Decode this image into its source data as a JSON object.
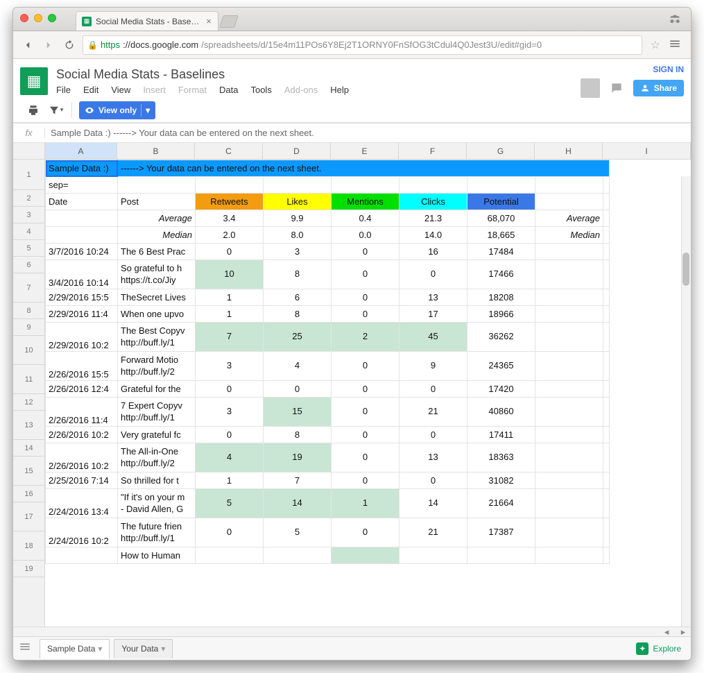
{
  "browser": {
    "tab_title": "Social Media Stats - Basel…",
    "url_https": "https",
    "url_host": "://docs.google.com",
    "url_rest": "/spreadsheets/d/15e4m11POs6Y8Ej2T1ORNY0FnSfOG3tCdul4Q0Jest3U/edit#gid=0"
  },
  "header": {
    "title": "Social Media Stats - Baselines",
    "sign_in": "SIGN IN",
    "share": "Share",
    "menu": {
      "file": "File",
      "edit": "Edit",
      "view": "View",
      "insert": "Insert",
      "format": "Format",
      "data": "Data",
      "tools": "Tools",
      "addons": "Add-ons",
      "help": "Help"
    }
  },
  "toolbar": {
    "view_only": "View only"
  },
  "formula_bar": "Sample Data :)  ------> Your data can be entered on the next sheet.",
  "columns": [
    "A",
    "B",
    "C",
    "D",
    "E",
    "F",
    "G",
    "H",
    "I"
  ],
  "row1": {
    "a": "Sample Data :)",
    "rest": "------> Your data can be entered on the next sheet."
  },
  "row2a": "sep=",
  "row3": {
    "date": "Date",
    "post": "Post",
    "rt": "Retweets",
    "likes": "Likes",
    "mentions": "Mentions",
    "clicks": "Clicks",
    "potential": "Potential"
  },
  "avg_row": {
    "label": "Average",
    "rt": "3.4",
    "likes": "9.9",
    "mentions": "0.4",
    "clicks": "21.3",
    "potential": "68,070",
    "label2": "Average"
  },
  "med_row": {
    "label": "Median",
    "rt": "2.0",
    "likes": "8.0",
    "mentions": "0.0",
    "clicks": "14.0",
    "potential": "18,665",
    "label2": "Median"
  },
  "data_rows": [
    {
      "n": "6",
      "date": "3/7/2016 10:24",
      "post": "The 6 Best Prac",
      "rt": "0",
      "likes": "3",
      "mentions": "0",
      "clicks": "16",
      "pot": "17484",
      "hl": []
    },
    {
      "n": "7",
      "date": "3/4/2016 10:14",
      "post": "So grateful to h\nhttps://t.co/Jiy",
      "rt": "10",
      "likes": "8",
      "mentions": "0",
      "clicks": "0",
      "pot": "17466",
      "hl": [
        "rt"
      ],
      "tall": true
    },
    {
      "n": "8",
      "date": "2/29/2016 15:5",
      "post": "TheSecret Lives",
      "rt": "1",
      "likes": "6",
      "mentions": "0",
      "clicks": "13",
      "pot": "18208",
      "hl": []
    },
    {
      "n": "9",
      "date": "2/29/2016 11:4",
      "post": "When one upvo",
      "rt": "1",
      "likes": "8",
      "mentions": "0",
      "clicks": "17",
      "pot": "18966",
      "hl": []
    },
    {
      "n": "10",
      "date": "2/29/2016 10:2",
      "post": "The Best Copyv\nhttp://buff.ly/1",
      "rt": "7",
      "likes": "25",
      "mentions": "2",
      "clicks": "45",
      "pot": "36262",
      "hl": [
        "rt",
        "likes",
        "mentions",
        "clicks"
      ],
      "tall": true
    },
    {
      "n": "11",
      "date": "2/26/2016 15:5",
      "post": "Forward Motio\nhttp://buff.ly/2",
      "rt": "3",
      "likes": "4",
      "mentions": "0",
      "clicks": "9",
      "pot": "24365",
      "hl": [],
      "tall": true
    },
    {
      "n": "12",
      "date": "2/26/2016 12:4",
      "post": "Grateful for the",
      "rt": "0",
      "likes": "0",
      "mentions": "0",
      "clicks": "0",
      "pot": "17420",
      "hl": []
    },
    {
      "n": "13",
      "date": "2/26/2016 11:4",
      "post": "7 Expert Copyv\nhttp://buff.ly/1",
      "rt": "3",
      "likes": "15",
      "mentions": "0",
      "clicks": "21",
      "pot": "40860",
      "hl": [
        "likes"
      ],
      "tall": true
    },
    {
      "n": "14",
      "date": "2/26/2016 10:2",
      "post": "Very grateful fc",
      "rt": "0",
      "likes": "8",
      "mentions": "0",
      "clicks": "0",
      "pot": "17411",
      "hl": []
    },
    {
      "n": "15",
      "date": "2/26/2016 10:2",
      "post": "The All-in-One \nhttp://buff.ly/2",
      "rt": "4",
      "likes": "19",
      "mentions": "0",
      "clicks": "13",
      "pot": "18363",
      "hl": [
        "rt",
        "likes"
      ],
      "tall": true
    },
    {
      "n": "16",
      "date": "2/25/2016 7:14",
      "post": "So thrilled for t",
      "rt": "1",
      "likes": "7",
      "mentions": "0",
      "clicks": "0",
      "pot": "31082",
      "hl": []
    },
    {
      "n": "17",
      "date": "2/24/2016 13:4",
      "post": "\"If it's on your m\n- David Allen, G",
      "rt": "5",
      "likes": "14",
      "mentions": "1",
      "clicks": "14",
      "pot": "21664",
      "hl": [
        "rt",
        "likes",
        "mentions"
      ],
      "tall": true
    },
    {
      "n": "18",
      "date": "2/24/2016 10:2",
      "post": "The future frien\nhttp://buff.ly/1",
      "rt": "0",
      "likes": "5",
      "mentions": "0",
      "clicks": "21",
      "pot": "17387",
      "hl": [],
      "tall": true
    },
    {
      "n": "19",
      "date": "",
      "post": "How to Human",
      "rt": "",
      "likes": "",
      "mentions": "",
      "clicks": "",
      "pot": "",
      "hl": [
        "mentions"
      ]
    }
  ],
  "tabs": {
    "t1": "Sample Data",
    "t2": "Your Data",
    "explore": "Explore"
  }
}
